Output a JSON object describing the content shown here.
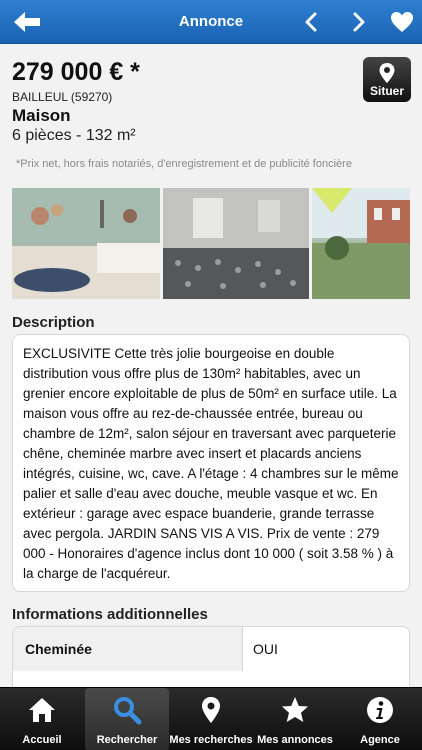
{
  "header": {
    "title": "Annonce"
  },
  "listing": {
    "price": "279 000 € *",
    "city": "BAILLEUL (59270)",
    "type": "Maison",
    "rooms": "6 pièces - 132 m²",
    "disclaimer": "*Prix net, hors frais notariés, d'enregistrement et de publicité foncière",
    "situer_label": "Situer"
  },
  "description": {
    "title": "Description",
    "text": "EXCLUSIVITE Cette très jolie bourgeoise en double distribution vous offre plus de 130m² habitables, avec un grenier encore exploitable de plus de 50m² en surface utile. La maison vous offre au rez-de-chaussée entrée, bureau ou chambre de 12m², salon séjour en traversant avec parqueterie chêne, cheminée marbre avec insert et placards anciens intégrés, cuisine, wc, cave. A l'étage : 4 chambres sur le même palier et salle d'eau avec douche, meuble vasque et wc. En extérieur : garage avec espace buanderie, grande terrasse avec pergola. JARDIN SANS VIS A VIS. Prix de vente : 279 000 - Honoraires d'agence inclus dont 10 000 ( soit 3.58 % ) à la charge de l'acquéreur."
  },
  "info": {
    "title": "Informations additionnelles",
    "rows": [
      {
        "key": "Cheminée",
        "value": "OUI"
      }
    ]
  },
  "tabs": [
    {
      "label": "Accueil",
      "icon": "home-icon"
    },
    {
      "label": "Rechercher",
      "icon": "search-icon",
      "active": true
    },
    {
      "label": "Mes recherches",
      "icon": "map-pin-icon"
    },
    {
      "label": "Mes annonces",
      "icon": "star-icon"
    },
    {
      "label": "Agence",
      "icon": "info-icon"
    }
  ],
  "colors": {
    "header": "#2f7fd0",
    "tabbar": "#1a1a1a"
  }
}
